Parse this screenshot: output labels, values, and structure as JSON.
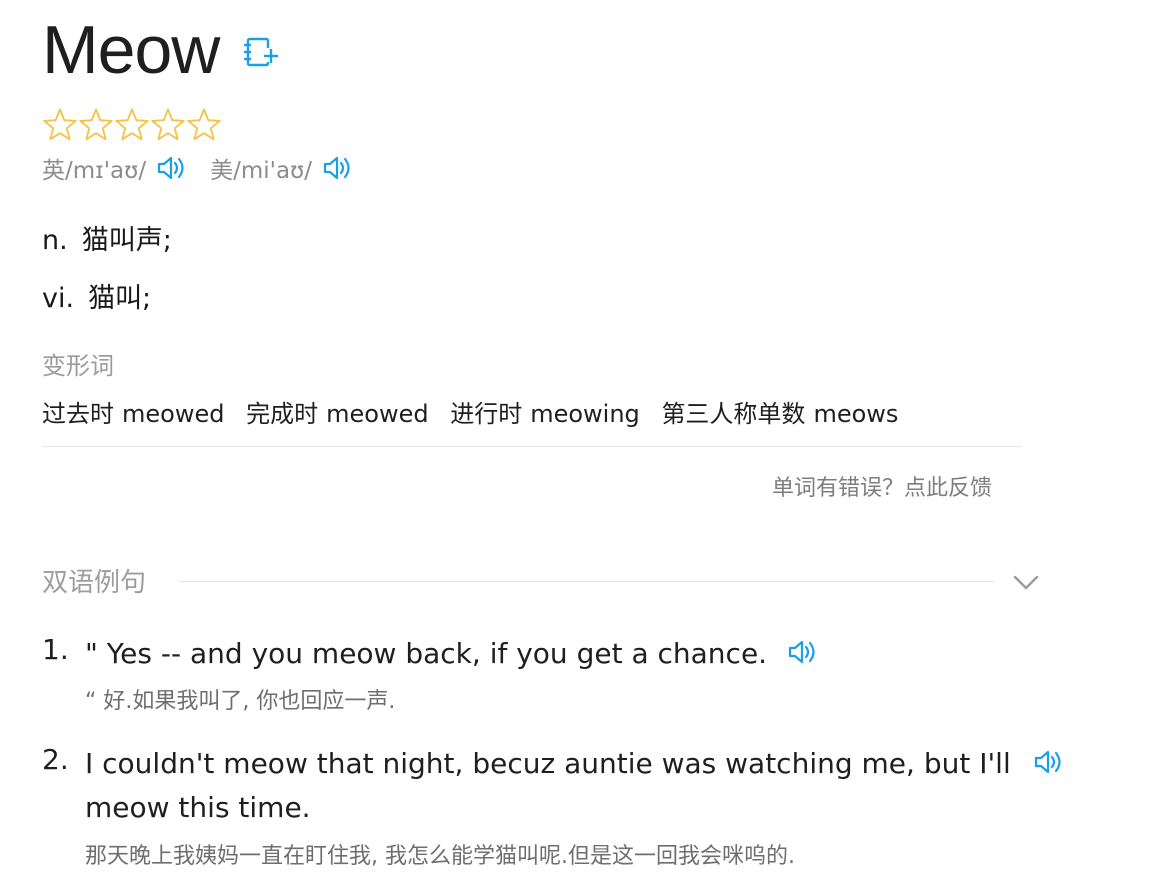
{
  "word": {
    "title": "Meow",
    "add_icon": "add-to-wordbook-icon",
    "rating": {
      "filled": 0,
      "max": 5
    },
    "star_icon": "star-outline-icon",
    "phonetics": [
      {
        "region": "英",
        "ipa": "/mɪ'aʊ/",
        "speaker_icon": "speaker-icon"
      },
      {
        "region": "美",
        "ipa": "/mi'aʊ/",
        "speaker_icon": "speaker-icon"
      }
    ],
    "definitions": [
      {
        "pos": "n.",
        "meaning": "猫叫声;"
      },
      {
        "pos": "vi.",
        "meaning": "猫叫;"
      }
    ]
  },
  "word_forms": {
    "label": "变形词",
    "items": [
      {
        "type": "过去时",
        "value": "meowed"
      },
      {
        "type": "完成时",
        "value": "meowed"
      },
      {
        "type": "进行时",
        "value": "meowing"
      },
      {
        "type": "第三人称单数",
        "value": "meows"
      }
    ]
  },
  "feedback_link": "单词有错误？点此反馈",
  "bilingual_examples": {
    "title": "双语例句",
    "toggle_icon": "chevron-down-icon",
    "items": [
      {
        "num": "1.",
        "en_lines": [
          "\" Yes -- and you meow back, if you get a chance."
        ],
        "cn": "“ 好.如果我叫了, 你也回应一声."
      },
      {
        "num": "2.",
        "en_lines": [
          "I couldn't meow that night, becuz auntie was watching me, but I'll",
          "meow this time."
        ],
        "cn": "那天晚上我姨妈一直在盯住我, 我怎么能学猫叫呢.但是这一回我会咪呜的."
      }
    ]
  },
  "colors": {
    "accent_blue": "#1aa0e6",
    "star_gold": "#f5c243",
    "text_dark": "#1f1f1f",
    "text_muted": "#9b9b9b"
  }
}
